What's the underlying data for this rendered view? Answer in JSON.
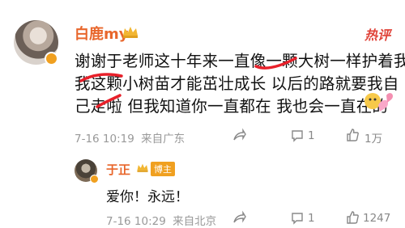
{
  "post": {
    "author": "白鹿my",
    "hot_badge": "热评",
    "lines": [
      "谢谢于老师这十年来一直像一颗大树一样护着我",
      "我这颗小树苗才能茁壮成长 以后的路就要我自",
      "己走啦 但我知道你一直都在 我也会一直在的"
    ],
    "date": "7-16 10:19",
    "location": "来自广东",
    "comments": "1",
    "likes": "1万"
  },
  "reply": {
    "author": "于正",
    "badge": "博主",
    "text": "爱你！永远！",
    "date": "7-16 10:29",
    "location": "来自北京",
    "comments": "1",
    "likes": "1247"
  },
  "colors": {
    "name": "#e8662b",
    "hot": "#e0443a",
    "meta": "#999999",
    "badge": "#f0a020"
  }
}
